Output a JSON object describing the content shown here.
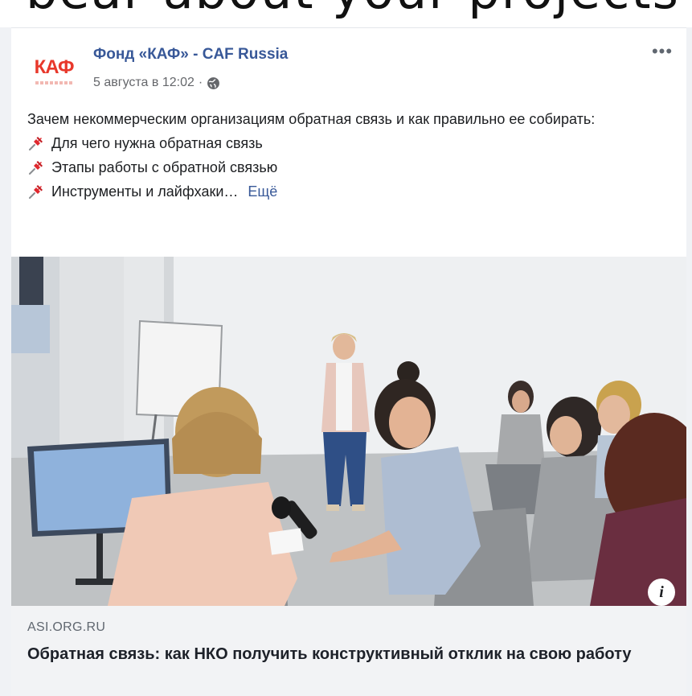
{
  "top_cut_text": "bear about your projects",
  "post": {
    "page_name": "Фонд «КАФ» - CAF Russia",
    "avatar_logo": "КАФ",
    "timestamp": "5 августа в 12:02",
    "meta_separator": "·",
    "privacy_icon": "globe-icon",
    "more_label": "•••",
    "intro_text": "Зачем некоммерческим организациям обратная связь и как правильно ее собирать:",
    "bullets": [
      "Для чего нужна обратная связь",
      "Этапы работы с обратной связью",
      "Инструменты и лайфхаки…"
    ],
    "bullet_icon": "pushpin-icon",
    "see_more": "Ещё",
    "info_label": "i"
  },
  "link_preview": {
    "domain": "ASI.ORG.RU",
    "title": "Обратная связь: как НКО получить конструктивный отклик на свою работу"
  },
  "colors": {
    "link_blue": "#385898",
    "logo_red": "#e8382b",
    "meta_gray": "#65676b",
    "link_box_bg": "#f2f3f5"
  }
}
